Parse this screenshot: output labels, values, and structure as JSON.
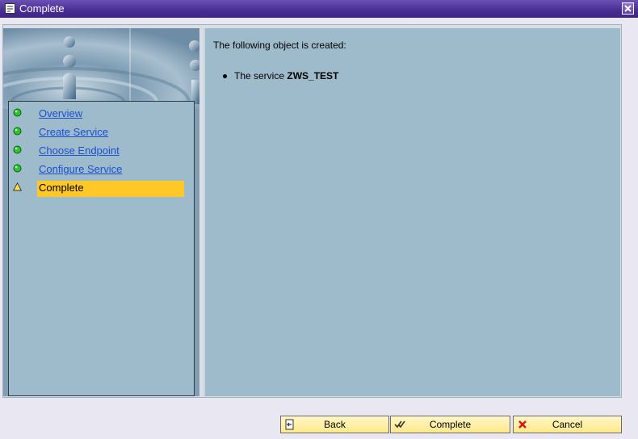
{
  "window": {
    "title": "Complete"
  },
  "nav": {
    "items": [
      {
        "label": "Overview",
        "status": "done"
      },
      {
        "label": "Create Service",
        "status": "done"
      },
      {
        "label": "Choose Endpoint",
        "status": "done"
      },
      {
        "label": "Configure Service",
        "status": "done"
      },
      {
        "label": "Complete",
        "status": "current"
      }
    ]
  },
  "content": {
    "heading": "The following object is created:",
    "item_prefix": "The service",
    "item_name": "ZWS_TEST"
  },
  "buttons": {
    "back": "Back",
    "complete": "Complete",
    "cancel": "Cancel"
  },
  "colors": {
    "accent": "#ffc826",
    "pane": "#9ebbcb",
    "link": "#1a4fd0",
    "done": "#2fc12f"
  }
}
